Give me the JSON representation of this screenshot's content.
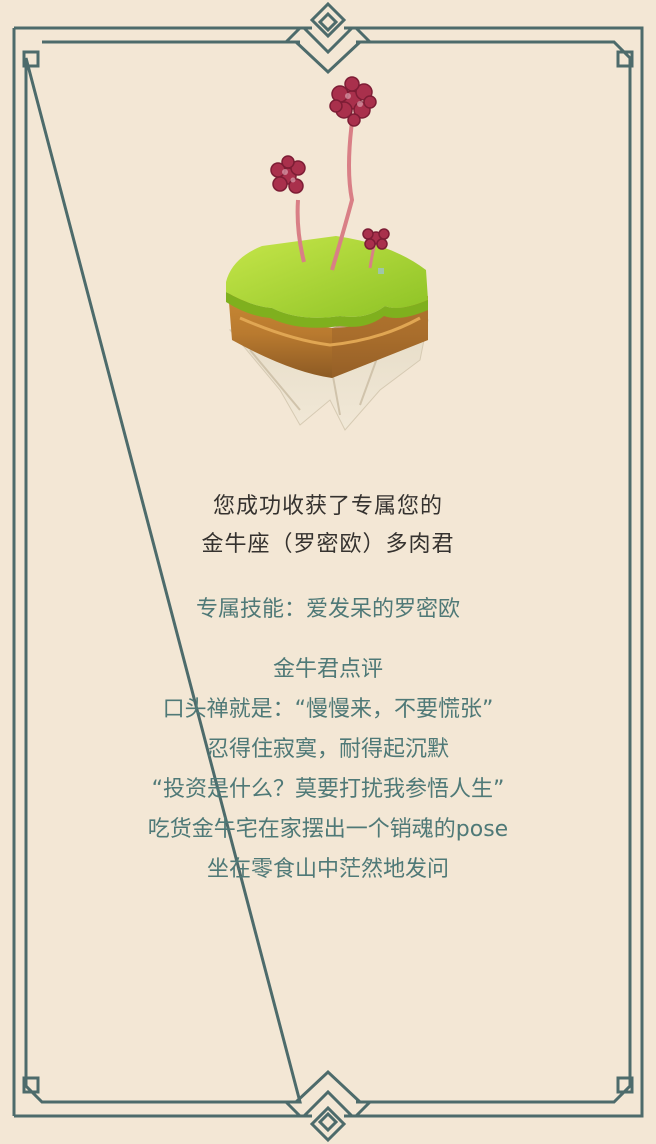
{
  "colors": {
    "background": "#f3e7d5",
    "frame": "#4d6b6b",
    "title_text": "#35322f",
    "body_text": "#4f7977"
  },
  "illustration": {
    "icon": "floating-island-with-succulents-icon"
  },
  "title": {
    "line1": "您成功收获了专属您的",
    "line2": "金牛座（罗密欧）多肉君"
  },
  "skill": "专属技能：爱发呆的罗密欧",
  "review": {
    "heading": "金牛君点评",
    "lines": [
      "口头禅就是：“慢慢来，不要慌张”",
      "忍得住寂寞，耐得起沉默",
      "“投资是什么？莫要打扰我参悟人生”",
      "吃货金牛宅在家摆出一个销魂的pose",
      "坐在零食山中茫然地发问"
    ]
  }
}
